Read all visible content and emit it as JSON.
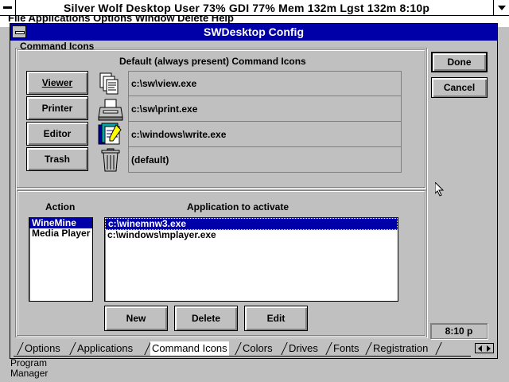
{
  "statusbar": {
    "text": "Silver Wolf Desktop     User 73%  GDI 77%  Mem 132m  Lgst 132m  8:10p"
  },
  "background_menu": {
    "text": "File  Applications  Options  Window  Delete  Help"
  },
  "background_desktop": {
    "program_manager_label": "Program Manager"
  },
  "window": {
    "title": "SWDesktop Config",
    "command_icons_group": {
      "label": "Command Icons",
      "default_header": "Default (always present) Command Icons",
      "rows": [
        {
          "button": "Viewer",
          "mnemonic_index": 0,
          "icon": "viewer-icon",
          "path": "c:\\sw\\view.exe"
        },
        {
          "button": "Printer",
          "mnemonic_index": 0,
          "icon": "printer-icon",
          "path": "c:\\sw\\print.exe"
        },
        {
          "button": "Editor",
          "mnemonic_index": 1,
          "icon": "editor-icon",
          "path": "c:\\windows\\write.exe"
        },
        {
          "button": "Trash",
          "mnemonic_index": 0,
          "icon": "trash-icon",
          "path": "(default)"
        }
      ]
    },
    "custom": {
      "action_header": "Action",
      "app_header": "Application to activate",
      "actions": [
        "WineMine",
        "Media Player"
      ],
      "selected_action": 0,
      "applications": [
        "c:\\winemnw3.exe",
        "c:\\windows\\mplayer.exe"
      ],
      "selected_app": 0,
      "buttons": {
        "new": "New",
        "delete": "Delete",
        "edit": "Edit"
      }
    },
    "done_label": "Done",
    "cancel_label": "Cancel",
    "time": "8:10 p",
    "tabs": [
      {
        "label": "Options",
        "active": false
      },
      {
        "label": "Applications",
        "active": false
      },
      {
        "label": "Command Icons",
        "active": true
      },
      {
        "label": "Colors",
        "active": false
      },
      {
        "label": "Drives",
        "active": false
      },
      {
        "label": "Fonts",
        "active": false
      },
      {
        "label": "Registration",
        "active": false
      }
    ]
  },
  "colors": {
    "title_bar": "#0000a8",
    "selection": "#0000a8",
    "face": "#c0c0c0"
  }
}
